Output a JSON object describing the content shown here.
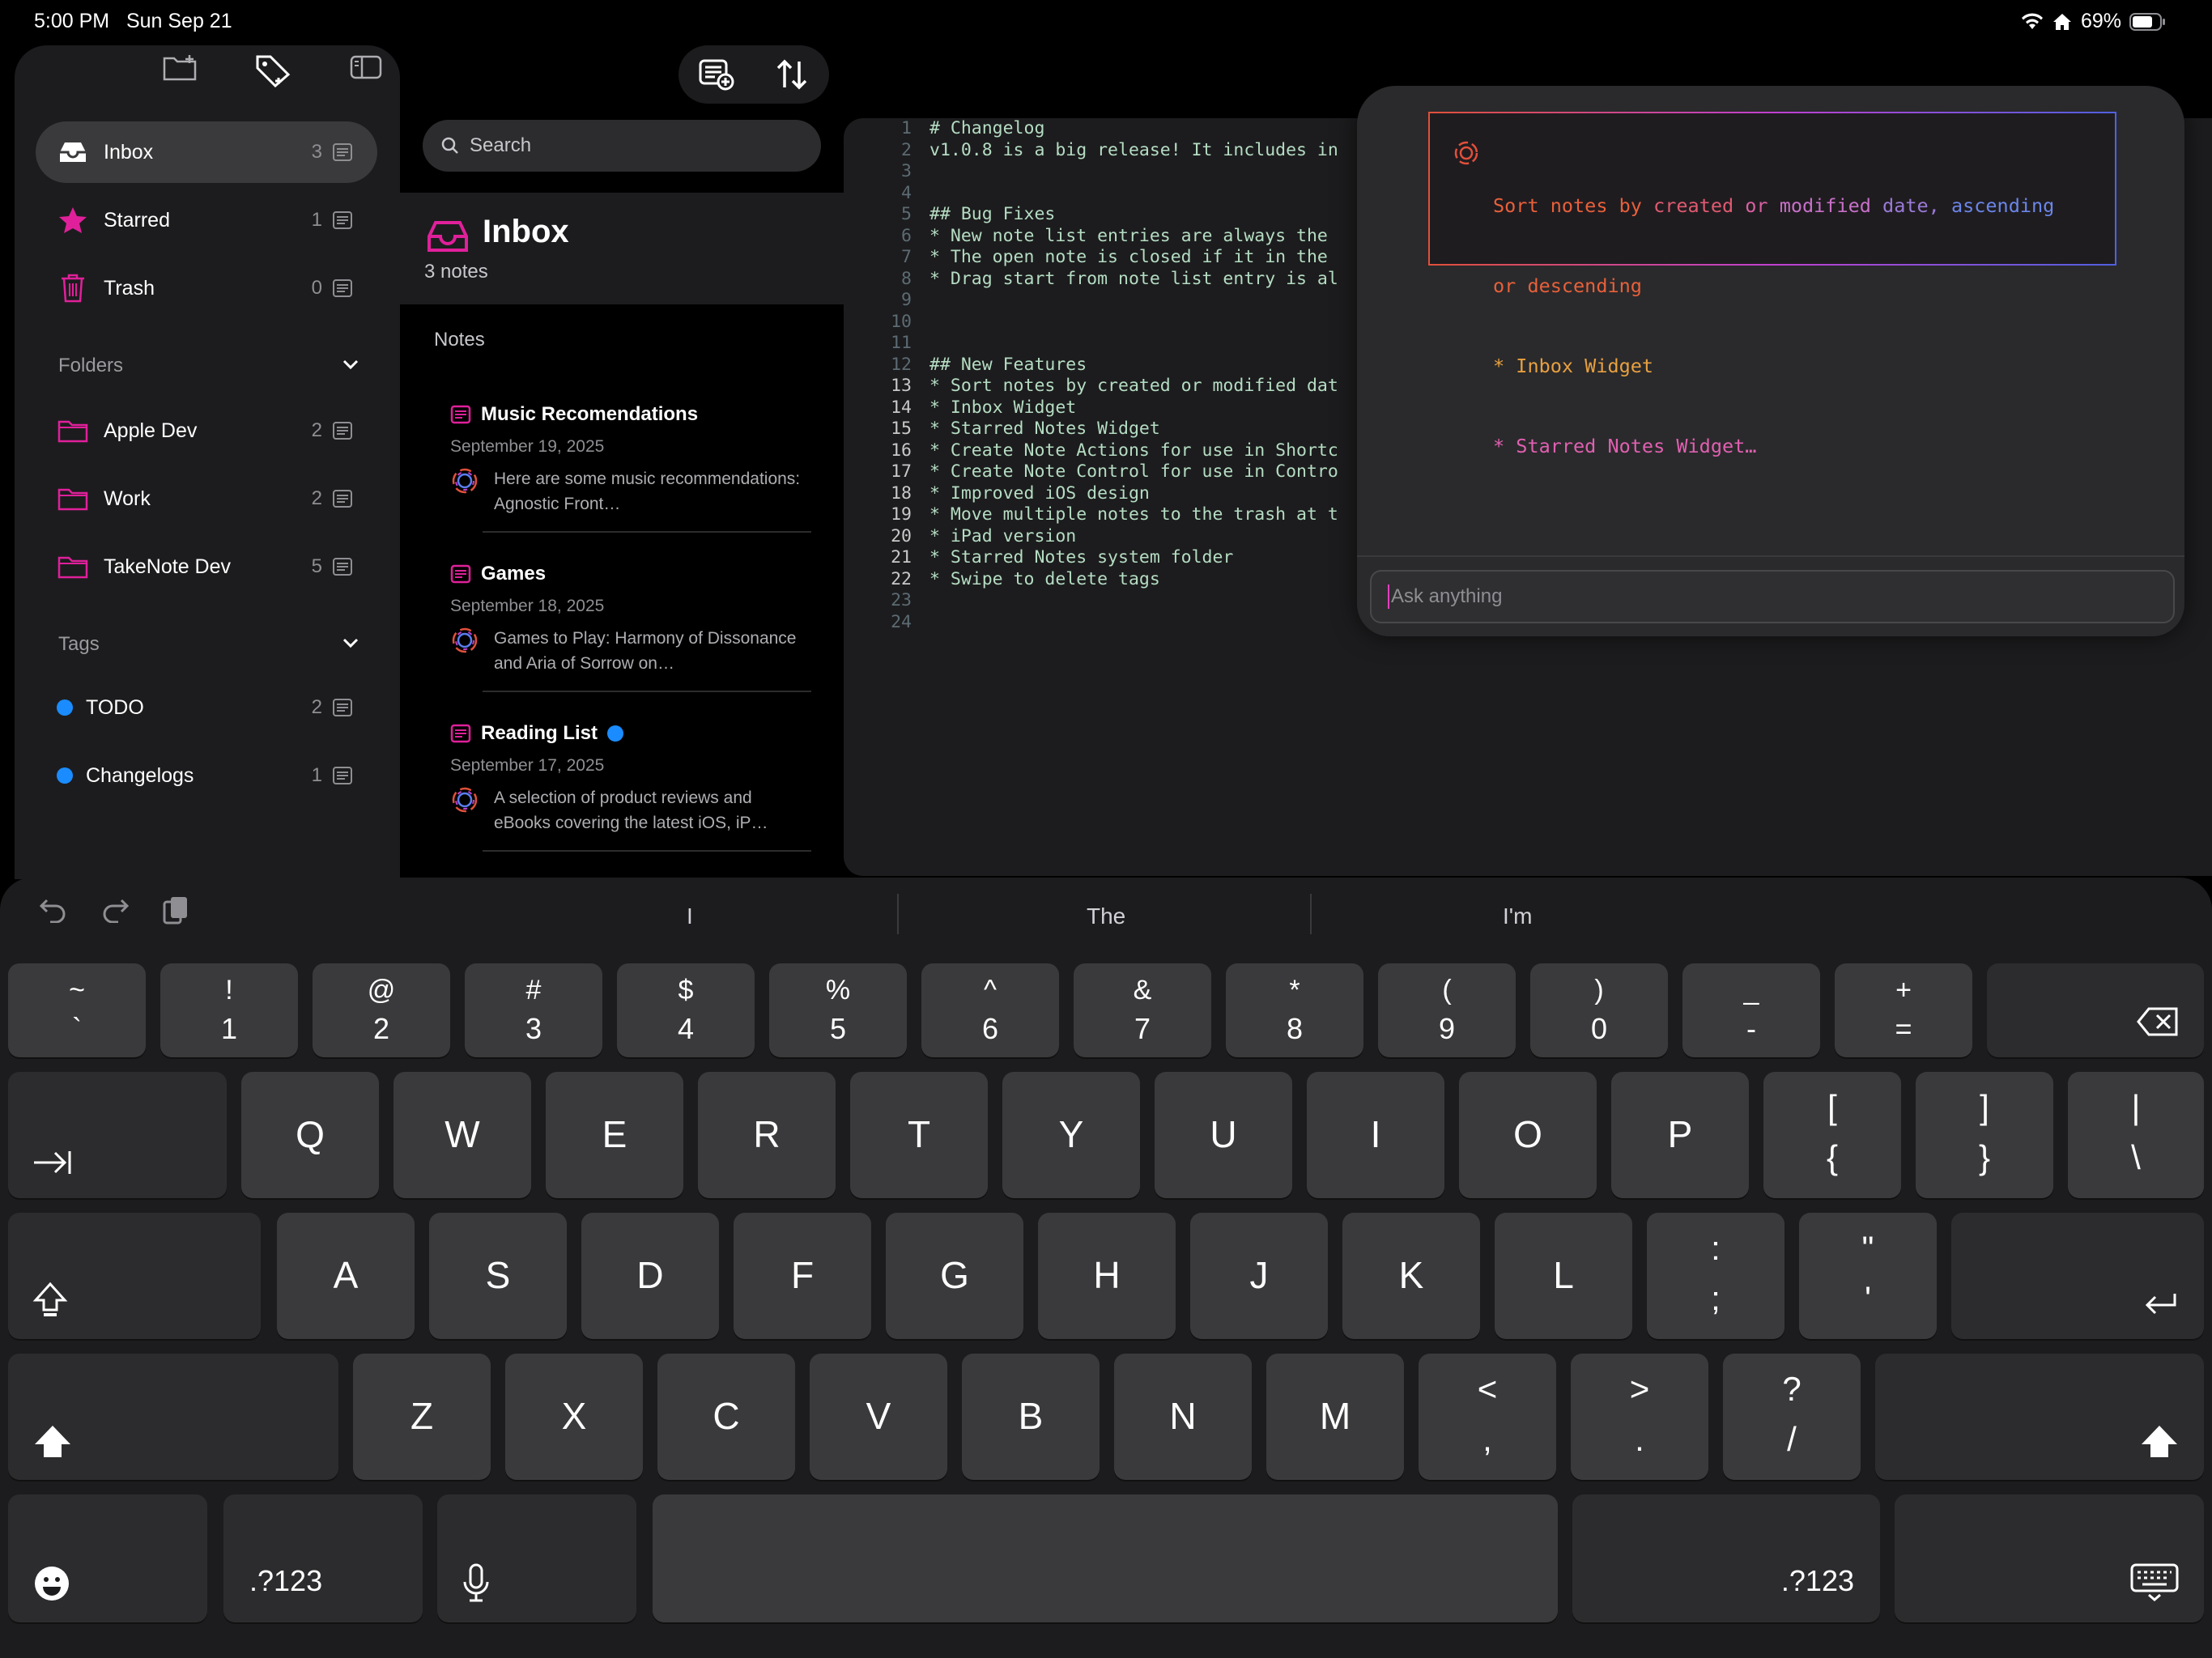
{
  "status_bar": {
    "time": "5:00 PM",
    "date": "Sun Sep 21",
    "battery": "69%"
  },
  "sidebar": {
    "items": [
      {
        "label": "Inbox",
        "count": "3"
      },
      {
        "label": "Starred",
        "count": "1"
      },
      {
        "label": "Trash",
        "count": "0"
      }
    ],
    "folders_header": "Folders",
    "folders": [
      {
        "label": "Apple Dev",
        "count": "2"
      },
      {
        "label": "Work",
        "count": "2"
      },
      {
        "label": "TakeNote Dev",
        "count": "5"
      }
    ],
    "tags_header": "Tags",
    "tags": [
      {
        "label": "TODO",
        "count": "2"
      },
      {
        "label": "Changelogs",
        "count": "1"
      }
    ]
  },
  "notes_list": {
    "search_placeholder": "Search",
    "title": "Inbox",
    "count": "3 notes",
    "section": "Notes",
    "notes": [
      {
        "title": "Music Recomendations",
        "date": "September 19, 2025",
        "snippet": "Here are some music recommendations: Agnostic Front…"
      },
      {
        "title": "Games",
        "date": "September 18, 2025",
        "snippet": "Games to Play: Harmony of Dissonance and Aria of Sorrow on…"
      },
      {
        "title": "Reading List",
        "date": "September 17, 2025",
        "snippet": "A selection of product reviews and eBooks covering the latest iOS, iP…"
      }
    ]
  },
  "editor": {
    "lines": [
      {
        "n": "1",
        "t": "# Changelog"
      },
      {
        "n": "2",
        "t": "v1.0.8 is a big release! It includes in"
      },
      {
        "n": "3",
        "t": ""
      },
      {
        "n": "4",
        "t": ""
      },
      {
        "n": "5",
        "t": "## Bug Fixes"
      },
      {
        "n": "6",
        "t": "* New note list entries are always the"
      },
      {
        "n": "7",
        "t": "* The open note is closed if it in the"
      },
      {
        "n": "8",
        "t": "* Drag start from note list entry is al"
      },
      {
        "n": "9",
        "t": ""
      },
      {
        "n": "10",
        "t": ""
      },
      {
        "n": "11",
        "t": ""
      },
      {
        "n": "12",
        "t": "## New Features"
      },
      {
        "n": "13",
        "t": "* Sort notes by created or modified dat"
      },
      {
        "n": "14",
        "t": "* Inbox Widget"
      },
      {
        "n": "15",
        "t": "* Starred Notes Widget"
      },
      {
        "n": "16",
        "t": "* Create Note Actions for use in Shortc"
      },
      {
        "n": "17",
        "t": "* Create Note Control for use in Contro"
      },
      {
        "n": "18",
        "t": "* Improved iOS design"
      },
      {
        "n": "19",
        "t": "* Move multiple notes to the trash at t"
      },
      {
        "n": "20",
        "t": "* iPad version"
      },
      {
        "n": "21",
        "t": "* Starred Notes system folder"
      },
      {
        "n": "22",
        "t": "* Swipe to delete tags"
      },
      {
        "n": "23",
        "t": ""
      },
      {
        "n": "24",
        "t": ""
      }
    ]
  },
  "ai_panel": {
    "quote": {
      "line1_parts": [
        "Sort notes by ",
        "created",
        " or ",
        "modified",
        " date, ",
        "ascending"
      ],
      "line2": "or descending",
      "line3": "* Inbox Widget",
      "line4": "* Starred Notes Widget…"
    },
    "ask_placeholder": "Ask anything"
  },
  "keyboard": {
    "suggestions": [
      "I",
      "The",
      "I'm"
    ],
    "number_row": [
      {
        "t": "~",
        "b": "`"
      },
      {
        "t": "!",
        "b": "1"
      },
      {
        "t": "@",
        "b": "2"
      },
      {
        "t": "#",
        "b": "3"
      },
      {
        "t": "$",
        "b": "4"
      },
      {
        "t": "%",
        "b": "5"
      },
      {
        "t": "^",
        "b": "6"
      },
      {
        "t": "&",
        "b": "7"
      },
      {
        "t": "*",
        "b": "8"
      },
      {
        "t": "(",
        "b": "9"
      },
      {
        "t": ")",
        "b": "0"
      },
      {
        "t": "_",
        "b": "-"
      },
      {
        "t": "+",
        "b": "="
      }
    ],
    "row_q": [
      "Q",
      "W",
      "E",
      "R",
      "T",
      "Y",
      "U",
      "I",
      "O",
      "P"
    ],
    "row_q_sym": [
      {
        "t": "[",
        "b": "{"
      },
      {
        "t": "]",
        "b": "}"
      },
      {
        "t": "|",
        "b": "\\"
      }
    ],
    "row_a": [
      "A",
      "S",
      "D",
      "F",
      "G",
      "H",
      "J",
      "K",
      "L"
    ],
    "row_a_sym": [
      {
        "t": ":",
        "b": ";"
      },
      {
        "t": "\"",
        "b": "'"
      }
    ],
    "row_z": [
      "Z",
      "X",
      "C",
      "V",
      "B",
      "N",
      "M"
    ],
    "row_z_sym": [
      {
        "t": "<",
        "b": ","
      },
      {
        "t": ">",
        "b": "."
      },
      {
        "t": "?",
        "b": "/"
      }
    ],
    "num_label": ".?123"
  }
}
